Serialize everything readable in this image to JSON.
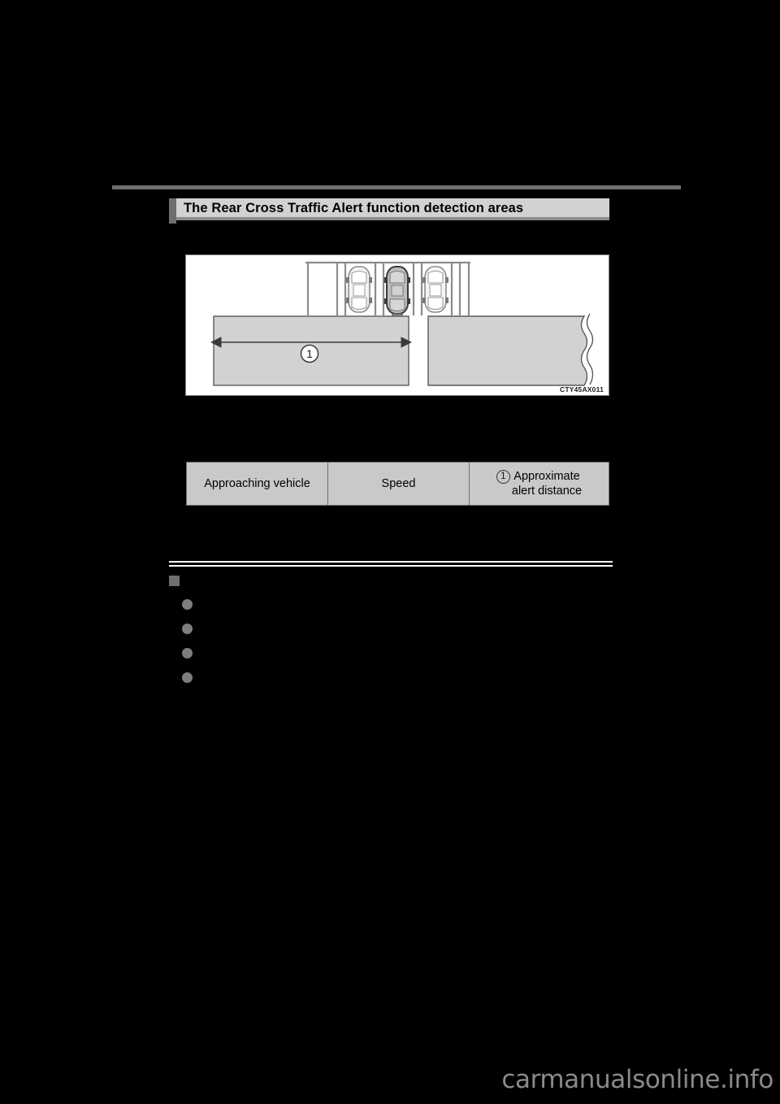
{
  "page": {
    "background_color": "#000000",
    "rule_color": "#6e6e6e"
  },
  "section_header": {
    "title": "The Rear Cross Traffic Alert function detection areas",
    "bar_color": "#d2d2d2",
    "tab_color": "#6e6e6e"
  },
  "figure": {
    "code": "CTY45AX011",
    "callout_number": "1",
    "detection_area_fill": "#d2d2d2",
    "own_vehicle_fill": "#bdbdbd",
    "other_vehicle_fill": "#f4f4f0",
    "arrow_color": "#8c8c8c",
    "description": "Top view of a parking lot: three vehicles in adjacent parking stalls, the center (own) vehicle reversing out, with left and right rear cross traffic detection areas shown as shaded rectangles and a horizontal double arrow marking the approximate alert distance",
    "vehicles": [
      {
        "name": "left-parked-vehicle",
        "highlighted": false
      },
      {
        "name": "own-vehicle",
        "highlighted": true
      },
      {
        "name": "right-parked-vehicle",
        "highlighted": false
      }
    ],
    "detection_areas": [
      {
        "name": "left-detection-area",
        "has_arrow": true,
        "callout": "1"
      },
      {
        "name": "right-detection-area",
        "has_arrow": false,
        "callout": ""
      }
    ]
  },
  "spec_table": {
    "headers": [
      {
        "label": "Approaching vehicle",
        "callout": ""
      },
      {
        "label": "Speed",
        "callout": ""
      },
      {
        "label": "Approximate\nalert distance",
        "callout": "1"
      }
    ],
    "header_col3_line1": "Approximate",
    "header_col3_line2": "alert distance",
    "fill_color": "#c9c9c9",
    "border_color": "#6e6e6e"
  },
  "notes": {
    "heading": "",
    "items": [
      "",
      "",
      "",
      ""
    ],
    "square_marker_color": "#6e6e6e",
    "dot_marker_color": "#7d7d7d"
  },
  "watermark": {
    "text": "carmanualsonline.info",
    "color": "#8a8a8a"
  }
}
